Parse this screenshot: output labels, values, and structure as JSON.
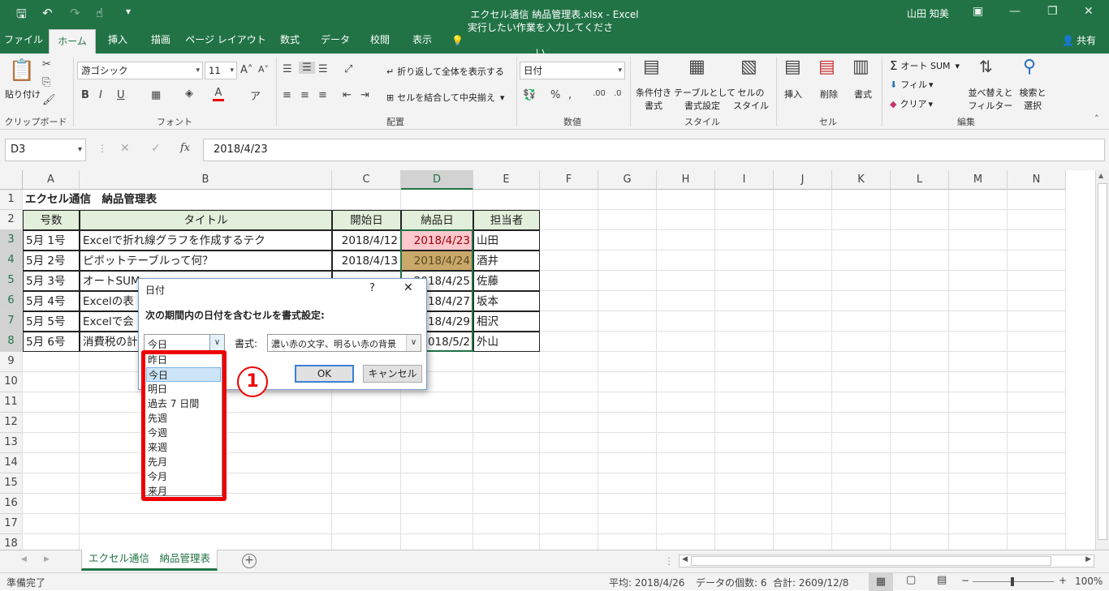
{
  "window": {
    "doc_title": "エクセル通信 納品管理表.xlsx - Excel",
    "user": "山田 知美"
  },
  "tabs": [
    "ファイル",
    "ホーム",
    "挿入",
    "描画",
    "ページ レイアウト",
    "数式",
    "データ",
    "校閲",
    "表示"
  ],
  "tellme": "実行したい作業を入力してください",
  "share": "共有",
  "ribbon": {
    "paste": "貼り付け",
    "clipboard_group": "クリップボード",
    "font_name": "游ゴシック",
    "font_size": "11",
    "font_group": "フォント",
    "wrap_text": "折り返して全体を表示する",
    "merge_center": "セルを結合して中央揃え",
    "alignment_group": "配置",
    "number_format": "日付",
    "number_group": "数値",
    "cond_format": [
      "条件付き",
      "書式"
    ],
    "format_table": [
      "テーブルとして",
      "書式設定"
    ],
    "cell_styles": [
      "セルの",
      "スタイル"
    ],
    "styles_group": "スタイル",
    "insert": "挿入",
    "delete": "削除",
    "format": "書式",
    "cells_group": "セル",
    "autosum": "オート SUM",
    "fill": "フィル",
    "clear": "クリア",
    "sort_filter": [
      "並べ替えと",
      "フィルター"
    ],
    "find_select": [
      "検索と",
      "選択"
    ],
    "editing_group": "編集"
  },
  "formula_bar": {
    "name_box": "D3",
    "formula": "2018/4/23"
  },
  "columns": [
    "A",
    "B",
    "C",
    "D",
    "E",
    "F",
    "G",
    "H",
    "I",
    "J",
    "K",
    "L",
    "M",
    "N"
  ],
  "rows": [
    "1",
    "2",
    "3",
    "4",
    "5",
    "6",
    "7",
    "8",
    "9",
    "10",
    "11",
    "12",
    "13",
    "14",
    "15",
    "16",
    "17",
    "18"
  ],
  "sheet": {
    "title": "エクセル通信　納品管理表",
    "headers": [
      "号数",
      "タイトル",
      "開始日",
      "納品日",
      "担当者"
    ],
    "data": [
      [
        "5月 1号",
        "Excelで折れ線グラフを作成するテク",
        "2018/4/12",
        "2018/4/23",
        "山田"
      ],
      [
        "5月 2号",
        "ピボットテーブルって何？",
        "2018/4/13",
        "2018/4/24",
        "酒井"
      ],
      [
        "5月 3号",
        "オートSUM",
        "",
        "2018/4/25",
        "佐藤"
      ],
      [
        "5月 4号",
        "Excelの表",
        "",
        "2018/4/27",
        "坂本"
      ],
      [
        "5月 5号",
        "Excelで会",
        "",
        "2018/4/29",
        "相沢"
      ],
      [
        "5月 6号",
        "消費税の計",
        "",
        "2018/5/2",
        "外山"
      ]
    ]
  },
  "dialog": {
    "title": "日付",
    "help": "?",
    "close": "✕",
    "instruction": "次の期間内の日付を含むセルを書式設定:",
    "selected": "今日",
    "format_label": "書式:",
    "format_value": "濃い赤の文字、明るい赤の背景",
    "ok": "OK",
    "cancel": "キャンセル",
    "options": [
      "昨日",
      "今日",
      "明日",
      "過去 7 日間",
      "先週",
      "今週",
      "来週",
      "先月",
      "今月",
      "来月"
    ]
  },
  "annotation": "1",
  "sheet_tab": "エクセル通信　納品管理表",
  "status": {
    "ready": "準備完了",
    "average": "平均: 2018/4/26",
    "count": "データの個数: 6",
    "sum": "合計: 2609/12/8",
    "zoom": "100%"
  },
  "colors": {
    "excel_green": "#217346",
    "red_fill": "#ffc7ce",
    "red_text": "#9c0006",
    "header_fill": "#e2efda",
    "tan_fill": "#c9a869",
    "annotation_red": "#e00000"
  }
}
